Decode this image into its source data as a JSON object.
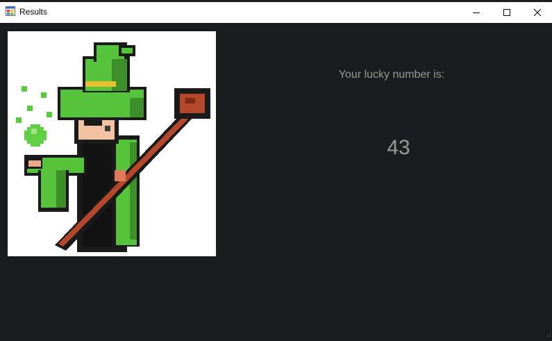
{
  "window": {
    "title": "Results",
    "icons": {
      "app": "app-window-icon",
      "minimize": "minimize-icon",
      "maximize": "maximize-icon",
      "close": "close-icon"
    }
  },
  "picture": {
    "subject": "pixel-art-wizard-image"
  },
  "result": {
    "label": "Your lucky number is:",
    "number": "43"
  },
  "colors": {
    "background": "#1a1d1d",
    "text": "#9a9a9a",
    "titlebar": "#ffffff"
  }
}
